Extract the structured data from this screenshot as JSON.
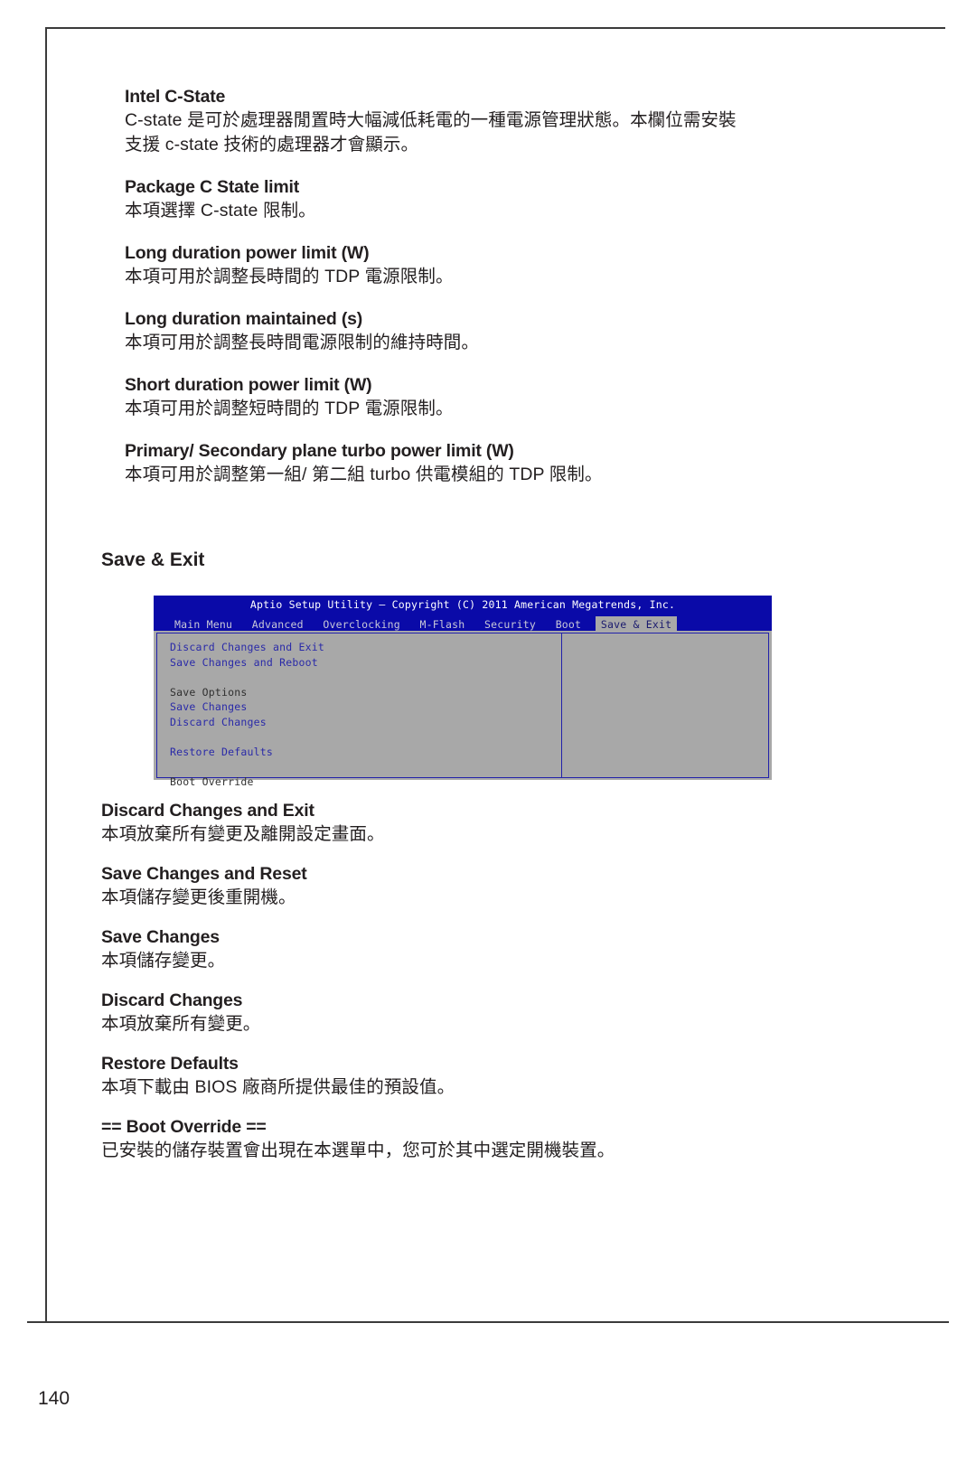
{
  "page": {
    "number": "140"
  },
  "sections": [
    {
      "title": "Intel C-State",
      "lines": [
        "C-state 是可於處理器閒置時大幅減低耗電的一種電源管理狀態。本欄位需安裝",
        "支援 c-state  技術的處理器才會顯示。"
      ]
    },
    {
      "title": "Package C State limit",
      "lines": [
        "本項選擇 C-state 限制。"
      ]
    },
    {
      "title": "Long duration power limit (W)",
      "lines": [
        "本項可用於調整長時間的 TDP 電源限制。"
      ]
    },
    {
      "title": "Long duration maintained (s)",
      "lines": [
        "本項可用於調整長時間電源限制的維持時間。"
      ]
    },
    {
      "title": "Short duration power limit (W)",
      "lines": [
        "本項可用於調整短時間的 TDP 電源限制。"
      ]
    },
    {
      "title": "Primary/ Secondary plane turbo power limit (W)",
      "lines": [
        "本項可用於調整第一組/ 第二組 turbo 供電模組的 TDP 限制。"
      ]
    }
  ],
  "save_exit_heading": "Save & Exit",
  "bios": {
    "title": "Aptio Setup Utility – Copyright (C) 2011 American Megatrends, Inc.",
    "tabs": [
      {
        "label": "Main Menu",
        "active": false
      },
      {
        "label": "Advanced",
        "active": false
      },
      {
        "label": "Overclocking",
        "active": false
      },
      {
        "label": "M-Flash",
        "active": false
      },
      {
        "label": "Security",
        "active": false
      },
      {
        "label": "Boot",
        "active": false
      },
      {
        "label": "Save & Exit",
        "active": true
      }
    ],
    "menu_items": [
      {
        "label": "Discard Changes and Exit",
        "kind": "item"
      },
      {
        "label": "Save Changes and Reboot",
        "kind": "item"
      },
      {
        "label": "",
        "kind": "spacer"
      },
      {
        "label": "Save Options",
        "kind": "label"
      },
      {
        "label": "Save Changes",
        "kind": "item"
      },
      {
        "label": "Discard Changes",
        "kind": "item"
      },
      {
        "label": "",
        "kind": "spacer"
      },
      {
        "label": "Restore Defaults",
        "kind": "item"
      },
      {
        "label": "",
        "kind": "spacer"
      },
      {
        "label": "Boot Override",
        "kind": "label"
      }
    ],
    "colors": {
      "titlebar": "#0a0aa8",
      "body": "#a8a8a8",
      "item_text": "#2a2aa8",
      "label_text": "#303030",
      "active_tab_bg": "#a8a8a8"
    }
  },
  "sections_after": [
    {
      "title": "Discard Changes and Exit",
      "lines": [
        "本項放棄所有變更及離開設定畫面。"
      ]
    },
    {
      "title": "Save Changes and Reset",
      "lines": [
        "本項儲存變更後重開機。"
      ]
    },
    {
      "title": "Save Changes",
      "lines": [
        "本項儲存變更。"
      ]
    },
    {
      "title": "Discard Changes",
      "lines": [
        "本項放棄所有變更。"
      ]
    },
    {
      "title": "Restore Defaults",
      "lines": [
        "本項下載由 BIOS 廠商所提供最佳的預設值。"
      ]
    },
    {
      "title": "== Boot Override ==",
      "lines": [
        "已安裝的儲存裝置會出現在本選單中，您可於其中選定開機裝置。"
      ]
    }
  ]
}
